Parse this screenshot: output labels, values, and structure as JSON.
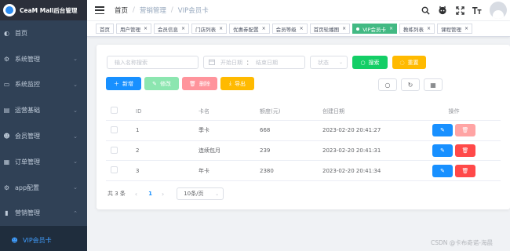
{
  "sidebar": {
    "app_title": "CeaM Mall后台管理",
    "items": [
      {
        "label": "首页",
        "icon": "dashboard-icon",
        "glyph": "◐",
        "expandable": false
      },
      {
        "label": "系统管理",
        "icon": "system-gear-icon",
        "glyph": "⚙",
        "expandable": true
      },
      {
        "label": "系统监控",
        "icon": "monitor-icon",
        "glyph": "▭",
        "expandable": true
      },
      {
        "label": "运营基础",
        "icon": "operation-icon",
        "glyph": "▤",
        "expandable": true
      },
      {
        "label": "会员管理",
        "icon": "member-icon",
        "glyph": "☻",
        "expandable": true
      },
      {
        "label": "订单管理",
        "icon": "order-icon",
        "glyph": "▦",
        "expandable": true
      },
      {
        "label": "app配置",
        "icon": "app-config-icon",
        "glyph": "⚙",
        "expandable": true
      },
      {
        "label": "营销管理",
        "icon": "marketing-icon",
        "glyph": "▮",
        "expandable": true,
        "expanded": true
      }
    ],
    "active_sub": {
      "label": "VIP会员卡",
      "icon": "vip-user-icon",
      "glyph": "☻"
    }
  },
  "navbar": {
    "breadcrumb": [
      "首页",
      "营销管理",
      "VIP会员卡"
    ],
    "icons": [
      "search-icon",
      "github-icon",
      "fullscreen-icon",
      "font-size-icon"
    ]
  },
  "tags": [
    {
      "label": "首页",
      "active": false,
      "closable": false
    },
    {
      "label": "用户管理",
      "active": false,
      "closable": true
    },
    {
      "label": "会员信息",
      "active": false,
      "closable": true
    },
    {
      "label": "门店列表",
      "active": false,
      "closable": true
    },
    {
      "label": "优惠券配置",
      "active": false,
      "closable": true
    },
    {
      "label": "会员等级",
      "active": false,
      "closable": true
    },
    {
      "label": "首页轮播图",
      "active": false,
      "closable": true
    },
    {
      "label": "VIP会员卡",
      "active": true,
      "closable": true
    },
    {
      "label": "教练列表",
      "active": false,
      "closable": true
    },
    {
      "label": "课程管理",
      "active": false,
      "closable": true
    }
  ],
  "search": {
    "name_placeholder": "输入名称搜索",
    "start_date_placeholder": "开始日期",
    "date_separator": "：",
    "end_date_placeholder": "结束日期",
    "status_placeholder": "状态",
    "search_label": "搜索",
    "reset_label": "重置"
  },
  "actions": {
    "add_label": "新增",
    "edit_label": "修改",
    "delete_label": "删除",
    "export_label": "导出"
  },
  "table": {
    "headers": {
      "id": "ID",
      "name": "卡名",
      "amount": "额度(元)",
      "created": "创建日期",
      "ops": "操作"
    },
    "rows": [
      {
        "id": "1",
        "name": "季卡",
        "amount": "668",
        "created": "2023-02-20 20:41:27",
        "delete_enabled": false
      },
      {
        "id": "2",
        "name": "连续包月",
        "amount": "239",
        "created": "2023-02-20 20:41:31",
        "delete_enabled": true
      },
      {
        "id": "3",
        "name": "年卡",
        "amount": "2380",
        "created": "2023-02-20 20:41:34",
        "delete_enabled": true
      }
    ]
  },
  "pagination": {
    "total_label": "共 3 条",
    "current_page": "1",
    "page_size_label": "10条/页"
  },
  "watermark": "CSDN @卡布奇诺-海晨",
  "colors": {
    "sidebar_bg": "#304156",
    "primary": "#1890ff",
    "success": "#13ce66",
    "warning": "#ffba00",
    "danger": "#ff4949",
    "tag_active": "#42b983"
  }
}
